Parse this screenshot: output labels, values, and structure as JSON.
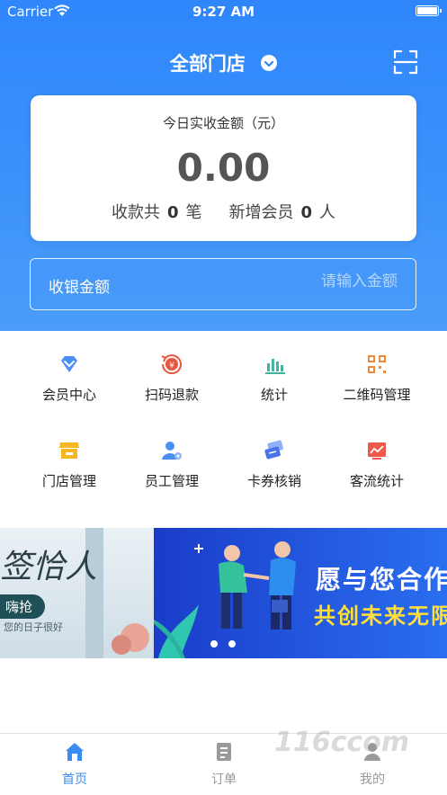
{
  "status_bar": {
    "carrier": "Carrier",
    "time": "9:27 AM"
  },
  "header": {
    "store_selector": "全部门店",
    "scan_icon": "scan-icon"
  },
  "summary": {
    "label": "今日实收金额（元）",
    "amount": "0.00",
    "payments_prefix": "收款共",
    "payments_count": "0",
    "payments_unit": "笔",
    "members_prefix": "新增会员",
    "members_count": "0",
    "members_unit": "人"
  },
  "cashier": {
    "label": "收银金额",
    "placeholder": "请输入金额"
  },
  "menu": [
    {
      "label": "会员中心",
      "icon": "diamond-icon"
    },
    {
      "label": "扫码退款",
      "icon": "refund-icon"
    },
    {
      "label": "统计",
      "icon": "bar-chart-icon"
    },
    {
      "label": "二维码管理",
      "icon": "qrcode-icon"
    },
    {
      "label": "门店管理",
      "icon": "store-icon"
    },
    {
      "label": "员工管理",
      "icon": "staff-icon"
    },
    {
      "label": "卡券核销",
      "icon": "coupon-icon"
    },
    {
      "label": "客流统计",
      "icon": "traffic-chart-icon"
    }
  ],
  "banner": {
    "right_title": "愿与您合作",
    "right_subtitle": "共创未来无限",
    "left_text": "签恰人",
    "left_tag": "嗨抢",
    "left_small": "您的日子很好"
  },
  "tabbar": [
    {
      "label": "首页",
      "icon": "home-icon",
      "active": true
    },
    {
      "label": "订单",
      "icon": "order-icon",
      "active": false
    },
    {
      "label": "我的",
      "icon": "profile-icon",
      "active": false
    }
  ],
  "watermark": "116ccom",
  "colors": {
    "primary": "#2f86fb",
    "active_tab": "#3a8cf5",
    "inactive_tab": "#999999",
    "banner_yellow": "#ffde3a"
  }
}
